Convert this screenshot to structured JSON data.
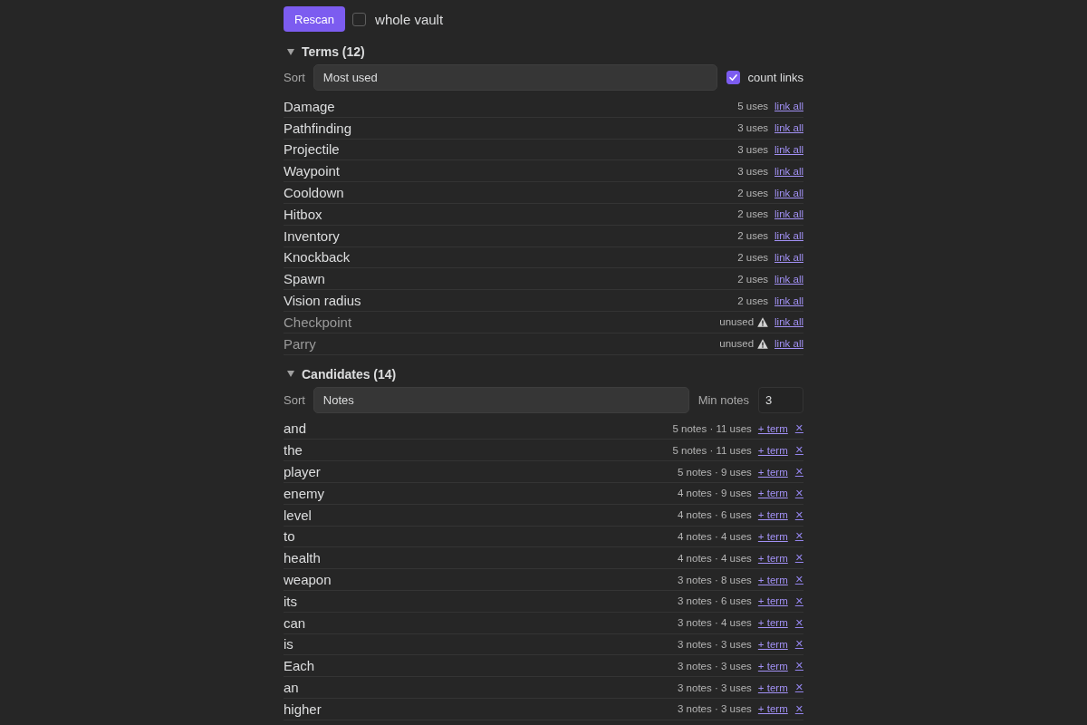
{
  "toolbar": {
    "rescan_button": "Rescan",
    "whole_vault": {
      "label": "whole vault",
      "checked": false
    }
  },
  "terms": {
    "title": "Terms (12)",
    "expanded": true,
    "sort_label": "Sort",
    "sort": "Most used",
    "count_links": {
      "label": "count links",
      "checked": true
    },
    "rows": [
      {
        "name": "Damage",
        "usage": "5 uses",
        "unused": false,
        "action": "link all"
      },
      {
        "name": "Pathfinding",
        "usage": "3 uses",
        "unused": false,
        "action": "link all"
      },
      {
        "name": "Projectile",
        "usage": "3 uses",
        "unused": false,
        "action": "link all"
      },
      {
        "name": "Waypoint",
        "usage": "3 uses",
        "unused": false,
        "action": "link all"
      },
      {
        "name": "Cooldown",
        "usage": "2 uses",
        "unused": false,
        "action": "link all"
      },
      {
        "name": "Hitbox",
        "usage": "2 uses",
        "unused": false,
        "action": "link all"
      },
      {
        "name": "Inventory",
        "usage": "2 uses",
        "unused": false,
        "action": "link all"
      },
      {
        "name": "Knockback",
        "usage": "2 uses",
        "unused": false,
        "action": "link all"
      },
      {
        "name": "Spawn",
        "usage": "2 uses",
        "unused": false,
        "action": "link all"
      },
      {
        "name": "Vision radius",
        "usage": "2 uses",
        "unused": false,
        "action": "link all"
      },
      {
        "name": "Checkpoint",
        "usage": "unused",
        "unused": true,
        "action": "link all"
      },
      {
        "name": "Parry",
        "usage": "unused",
        "unused": true,
        "action": "link all"
      }
    ]
  },
  "candidates": {
    "title": "Candidates (14)",
    "expanded": true,
    "sort_label": "Sort",
    "sort": "Notes",
    "min_notes_label": "Min notes",
    "min_notes": "3",
    "rows": [
      {
        "word": "and",
        "stats": "5 notes · 11 uses",
        "action": "+ term",
        "dismiss": "✕"
      },
      {
        "word": "the",
        "stats": "5 notes · 11 uses",
        "action": "+ term",
        "dismiss": "✕"
      },
      {
        "word": "player",
        "stats": "5 notes · 9 uses",
        "action": "+ term",
        "dismiss": "✕"
      },
      {
        "word": "enemy",
        "stats": "4 notes · 9 uses",
        "action": "+ term",
        "dismiss": "✕"
      },
      {
        "word": "level",
        "stats": "4 notes · 6 uses",
        "action": "+ term",
        "dismiss": "✕"
      },
      {
        "word": "to",
        "stats": "4 notes · 4 uses",
        "action": "+ term",
        "dismiss": "✕"
      },
      {
        "word": "health",
        "stats": "4 notes · 4 uses",
        "action": "+ term",
        "dismiss": "✕"
      },
      {
        "word": "weapon",
        "stats": "3 notes · 8 uses",
        "action": "+ term",
        "dismiss": "✕"
      },
      {
        "word": "its",
        "stats": "3 notes · 6 uses",
        "action": "+ term",
        "dismiss": "✕"
      },
      {
        "word": "can",
        "stats": "3 notes · 4 uses",
        "action": "+ term",
        "dismiss": "✕"
      },
      {
        "word": "is",
        "stats": "3 notes · 3 uses",
        "action": "+ term",
        "dismiss": "✕"
      },
      {
        "word": "Each",
        "stats": "3 notes · 3 uses",
        "action": "+ term",
        "dismiss": "✕"
      },
      {
        "word": "an",
        "stats": "3 notes · 3 uses",
        "action": "+ term",
        "dismiss": "✕"
      },
      {
        "word": "higher",
        "stats": "3 notes · 3 uses",
        "action": "+ term",
        "dismiss": "✕"
      }
    ]
  }
}
